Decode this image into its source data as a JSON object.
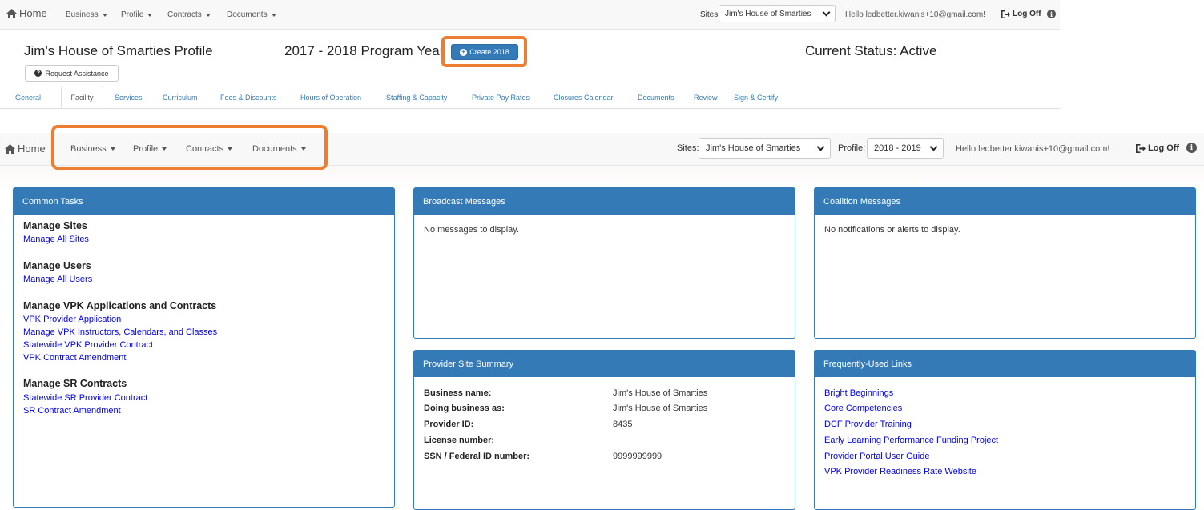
{
  "top": {
    "nav": {
      "home": "Home",
      "items": [
        "Business",
        "Profile",
        "Contracts",
        "Documents"
      ],
      "sites_label": "Sites:",
      "sites_value": "Jim's House of Smarties",
      "hello": "Hello ledbetter.kiwanis+10@gmail.com!",
      "logoff": "Log Off"
    },
    "profile_title": "Jim's House of Smarties Profile",
    "program_year": "2017 - 2018 Program Year",
    "create_button": "Create 2018",
    "status": "Current Status: Active",
    "request_button": "Request Assistance",
    "tabs": [
      "General",
      "Facility",
      "Services",
      "Curriculum",
      "Fees & Discounts",
      "Hours of Operation",
      "Staffing & Capacity",
      "Private Pay Rates",
      "Closures Calendar",
      "Documents",
      "Review",
      "Sign & Certify"
    ],
    "active_tab": "Facility"
  },
  "bottom": {
    "nav": {
      "home": "Home",
      "items": [
        "Business",
        "Profile",
        "Contracts",
        "Documents"
      ],
      "sites_label": "Sites:",
      "sites_value": "Jim's House of Smarties",
      "profile_label": "Profile:",
      "profile_value": "2018 - 2019",
      "hello": "Hello ledbetter.kiwanis+10@gmail.com!",
      "logoff": "Log Off"
    },
    "common_tasks": {
      "title": "Common Tasks",
      "groups": [
        {
          "heading": "Manage Sites",
          "links": [
            "Manage All Sites"
          ]
        },
        {
          "heading": "Manage Users",
          "links": [
            "Manage All Users"
          ]
        },
        {
          "heading": "Manage VPK Applications and Contracts",
          "links": [
            "VPK Provider Application",
            "Manage VPK Instructors, Calendars, and Classes",
            "Statewide VPK Provider Contract",
            "VPK Contract Amendment"
          ]
        },
        {
          "heading": "Manage SR Contracts",
          "links": [
            "Statewide SR Provider Contract",
            "SR Contract Amendment"
          ]
        }
      ]
    },
    "broadcast": {
      "title": "Broadcast Messages",
      "text": "No messages to display."
    },
    "coalition": {
      "title": "Coalition Messages",
      "text": "No notifications or alerts to display."
    },
    "summary": {
      "title": "Provider Site Summary",
      "rows": [
        {
          "label": "Business name:",
          "value": "Jim's House of Smarties"
        },
        {
          "label": "Doing business as:",
          "value": "Jim's House of Smarties"
        },
        {
          "label": "Provider ID:",
          "value": "8435"
        },
        {
          "label": "License number:",
          "value": ""
        },
        {
          "label": "SSN / Federal ID number:",
          "value": "9999999999"
        }
      ]
    },
    "links": {
      "title": "Frequently-Used Links",
      "items": [
        "Bright Beginnings",
        "Core Competencies",
        "DCF Provider Training",
        "Early Learning Performance Funding Project",
        "Provider Portal User Guide",
        "VPK Provider Readiness Rate Website"
      ]
    }
  },
  "colors": {
    "primary": "#337ab7",
    "highlight": "#ed7d31",
    "link": "#0000ee"
  },
  "icons": [
    "home-icon",
    "plus-circle-icon",
    "question-circle-icon",
    "logout-icon",
    "info-icon",
    "chevron-down-icon",
    "caret-down-icon"
  ]
}
